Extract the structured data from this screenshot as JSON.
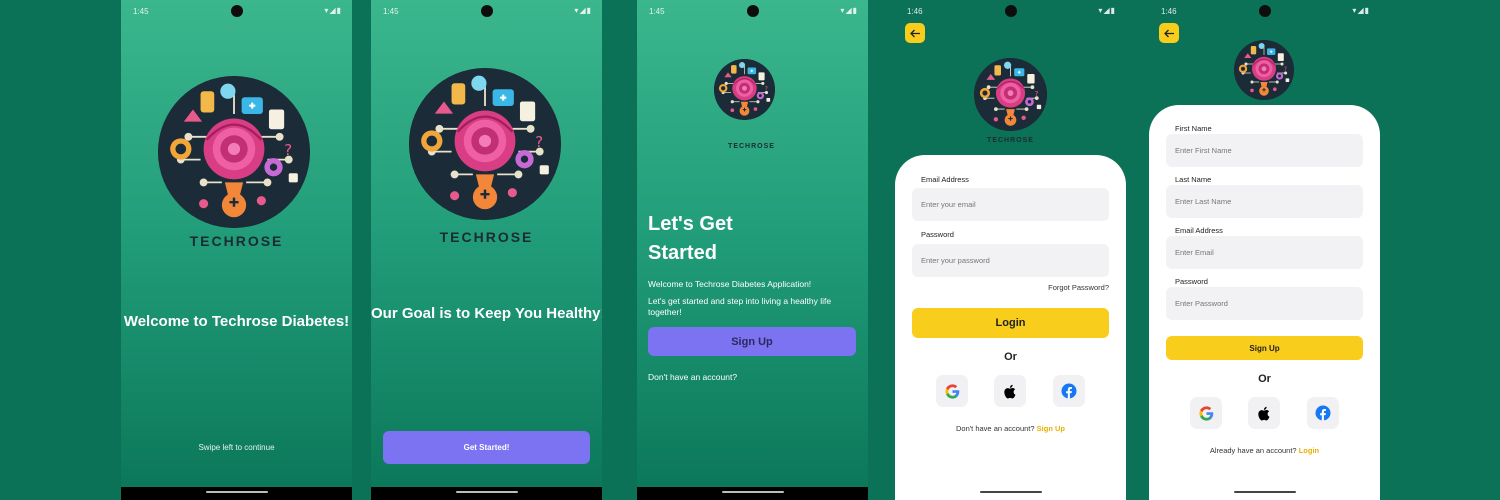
{
  "status": {
    "time_a": "1:45",
    "time_b": "1:46",
    "icons": "▾◢▮"
  },
  "brand": "TECHROSE",
  "screen1": {
    "headline": "Welcome to Techrose Diabetes!",
    "hint": "Swipe left to continue"
  },
  "screen2": {
    "headline": "Our Goal is to Keep You Healthy!",
    "button": "Get Started!"
  },
  "screen3": {
    "title_line1": "Let's Get",
    "title_line2": "Started",
    "welcome": "Welcome to Techrose Diabetes Application!",
    "body": "Let's get started and step into living a healthy life together!",
    "button": "Sign Up",
    "footer": "Don't have an account?"
  },
  "login": {
    "email_label": "Email Address",
    "email_placeholder": "Enter your email",
    "password_label": "Password",
    "password_placeholder": "Enter your password",
    "forgot": "Forgot Password?",
    "button": "Login",
    "or": "Or",
    "footer_text": "Don't have an account?",
    "footer_link": "Sign Up"
  },
  "signup": {
    "first_label": "First Name",
    "first_placeholder": "Enter First Name",
    "last_label": "Last Name",
    "last_placeholder": "Enter Last Name",
    "email_label": "Email Address",
    "email_placeholder": "Enter Email",
    "password_label": "Password",
    "password_placeholder": "Enter Password",
    "button": "Sign Up",
    "or": "Or",
    "footer_text": "Already have an account?",
    "footer_link": "Login"
  },
  "icons": {
    "back": "arrow-left-icon",
    "google": "google-icon",
    "apple": "apple-icon",
    "facebook": "facebook-icon"
  },
  "colors": {
    "background": "#0b7257",
    "accent_yellow": "#f9cd1c",
    "accent_purple": "#7b73f2",
    "link": "#e8b000"
  }
}
